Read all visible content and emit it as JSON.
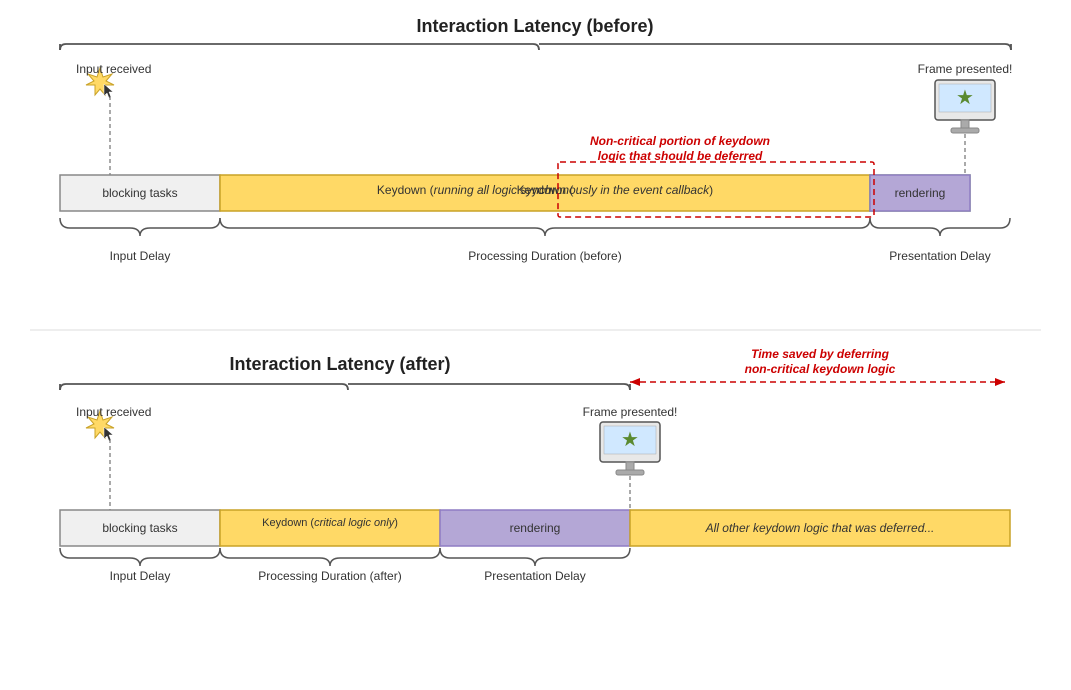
{
  "before": {
    "title": "Interaction Latency (before)",
    "input_received": "Input received",
    "frame_presented": "Frame presented!",
    "blocking_tasks": "blocking tasks",
    "keydown_label": "Keydown (running all logic synchronously in the event callback)",
    "rendering_label": "rendering",
    "input_delay_label": "Input Delay",
    "processing_duration_label": "Processing Duration (before)",
    "presentation_delay_label": "Presentation Delay",
    "red_annotation": "Non-critical portion of keydown\nlogic that should be deferred"
  },
  "after": {
    "title": "Interaction Latency (after)",
    "input_received": "Input received",
    "frame_presented": "Frame presented!",
    "blocking_tasks": "blocking tasks",
    "keydown_label": "Keydown (critical logic only)",
    "rendering_label": "rendering",
    "deferred_label": "All other keydown logic that was deferred...",
    "input_delay_label": "Input Delay",
    "processing_duration_label": "Processing Duration (after)",
    "presentation_delay_label": "Presentation Delay",
    "time_saved_label": "Time saved by deferring\nnon-critical keydown logic"
  },
  "colors": {
    "blocking": "#f0f0f0",
    "keydown": "#ffd966",
    "rendering": "#93c47d",
    "rendering_border": "#6aa84f",
    "red": "#cc0000",
    "text_dark": "#333"
  }
}
